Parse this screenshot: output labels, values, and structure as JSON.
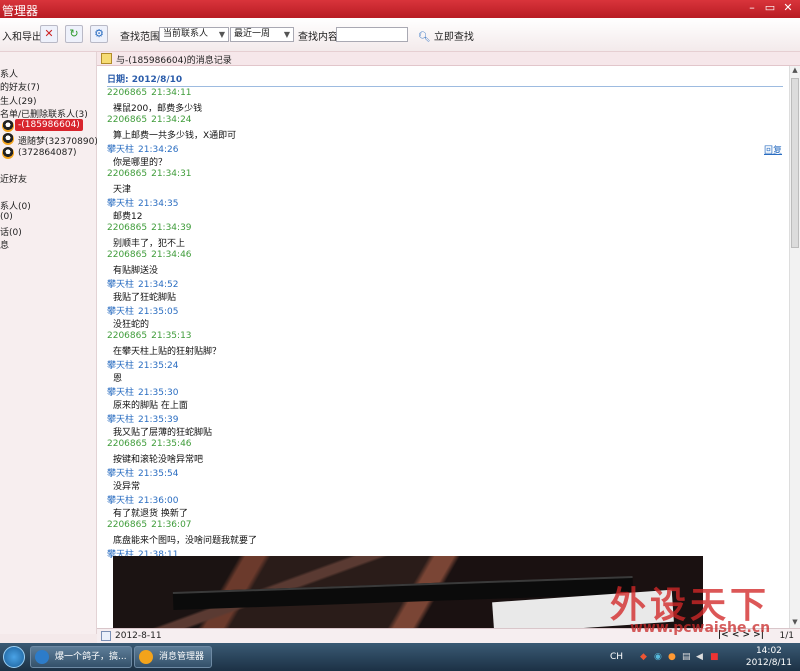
{
  "window": {
    "title": "管理器"
  },
  "toolbar": {
    "import_export_label": "入和导出",
    "search_scope_label": "查找范围:",
    "scope_select": "当前联系人",
    "time_select": "最近一周",
    "search_content_label": "查找内容:",
    "search_input_value": "",
    "search_now_label": "立即查找"
  },
  "tree": {
    "items": [
      "系人",
      "的好友(7)",
      "生人(29)",
      "名单/已删除联系人(3)",
      "-(185986604)",
      "遗随梦(32370890)",
      "(372864087)",
      "近好友",
      "系人(0)",
      "(0)",
      "话(0)",
      "息"
    ]
  },
  "log": {
    "header": "与-(185986604)的消息记录",
    "date_label": "日期: 2012/8/10",
    "reply_label": "回复",
    "messages": [
      {
        "sender": "2206865",
        "time": "21:34:11",
        "text": "裸鼠200，邮费多少钱",
        "color": "#3f9c3a"
      },
      {
        "sender": "2206865",
        "time": "21:34:24",
        "text": "算上邮费一共多少钱，X通即可",
        "color": "#3f9c3a"
      },
      {
        "sender": "攀天柱",
        "time": "21:34:26",
        "text": "你是哪里的？",
        "color": "#2a6dc1"
      },
      {
        "sender": "2206865",
        "time": "21:34:31",
        "text": "天津",
        "color": "#3f9c3a"
      },
      {
        "sender": "攀天柱",
        "time": "21:34:35",
        "text": "邮费12",
        "color": "#2a6dc1"
      },
      {
        "sender": "2206865",
        "time": "21:34:39",
        "text": "别顺丰了，犯不上",
        "color": "#3f9c3a"
      },
      {
        "sender": "2206865",
        "time": "21:34:46",
        "text": "有贴脚送没",
        "color": "#3f9c3a"
      },
      {
        "sender": "攀天柱",
        "time": "21:34:52",
        "text": "我贴了狂蛇脚贴",
        "color": "#2a6dc1"
      },
      {
        "sender": "攀天柱",
        "time": "21:35:05",
        "text": "没狂蛇的",
        "color": "#2a6dc1"
      },
      {
        "sender": "2206865",
        "time": "21:35:13",
        "text": "在攀天柱上贴的狂射贴脚？",
        "color": "#3f9c3a"
      },
      {
        "sender": "攀天柱",
        "time": "21:35:24",
        "text": "恩",
        "color": "#2a6dc1"
      },
      {
        "sender": "攀天柱",
        "time": "21:35:30",
        "text": "原来的脚贴 在上面",
        "color": "#2a6dc1"
      },
      {
        "sender": "攀天柱",
        "time": "21:35:39",
        "text": "我又贴了层薄的狂蛇脚贴",
        "color": "#2a6dc1"
      },
      {
        "sender": "2206865",
        "time": "21:35:46",
        "text": "按键和滚轮没啥异常吧",
        "color": "#3f9c3a"
      },
      {
        "sender": "攀天柱",
        "time": "21:35:54",
        "text": "没异常",
        "color": "#2a6dc1"
      },
      {
        "sender": "攀天柱",
        "time": "21:36:00",
        "text": "有了就退货 换新了",
        "color": "#2a6dc1"
      },
      {
        "sender": "2206865",
        "time": "21:36:07",
        "text": "底盘能来个图吗，没啥问题我就要了",
        "color": "#3f9c3a"
      },
      {
        "sender": "攀天柱",
        "time": "21:38:11",
        "text": "",
        "color": "#2a6dc1"
      }
    ]
  },
  "bottombar": {
    "date": "2012-8-11",
    "pager": "|< < > >|",
    "page": "1/1"
  },
  "watermark": {
    "brand": "外设天下",
    "url": "www.pcwaishe.cn"
  },
  "taskbar": {
    "task1": "爆一个鸽子，搞...",
    "task2": "消息管理器",
    "lang": "CH",
    "time": "14:02",
    "date": "2012/8/11"
  }
}
